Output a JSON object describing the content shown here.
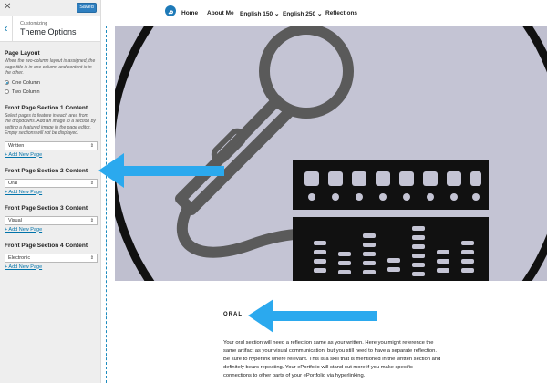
{
  "sidebar": {
    "save_label": "Saved",
    "breadcrumb": "Customizing",
    "panel_title": "Theme Options",
    "page_layout": {
      "title": "Page Layout",
      "description": "When the two-column layout is assigned, the page title is in one column and content is in the other.",
      "options": [
        "One Column",
        "Two Column"
      ],
      "selected": "One Column"
    },
    "sections": [
      {
        "title": "Front Page Section 1 Content",
        "description": "Select pages to feature in each area from the dropdowns. Add an image to a section by setting a featured image in the page editor. Empty sections will not be displayed.",
        "value": "Written",
        "add_link": "+ Add New Page"
      },
      {
        "title": "Front Page Section 2 Content",
        "value": "Oral",
        "add_link": "+ Add New Page"
      },
      {
        "title": "Front Page Section 3 Content",
        "value": "Visual",
        "add_link": "+ Add New Page"
      },
      {
        "title": "Front Page Section 4 Content",
        "value": "Electronic",
        "add_link": "+ Add New Page"
      }
    ]
  },
  "nav": {
    "items": [
      "Home",
      "About Me",
      "English 150",
      "English 250",
      "Reflections"
    ]
  },
  "content": {
    "heading": "ORAL",
    "body": "Your oral section will need a reflection same as your written. Here you might reference the same artifact as your visual communication, but you still need to have a separate reflection. Be sure to hyperlink where relevant. This is a skill that is mentioned in the written section and definitely bears repeating. Your ePortfolio will stand out more if you make specific connections to other parts of your ePortfolio via hyperlinking."
  },
  "colors": {
    "accent": "#1e8cbe",
    "arrow": "#2ba9ee",
    "hero_bg": "#bfbfcf",
    "icon_gray": "#5a5a5a"
  }
}
